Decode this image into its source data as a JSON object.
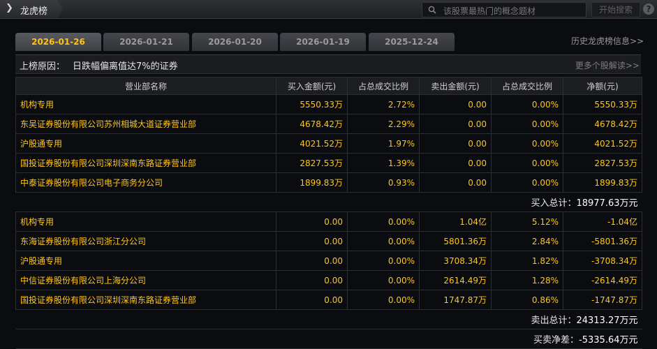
{
  "header": {
    "title": "龙虎榜",
    "search_placeholder": "该股票最热门的概念题材",
    "search_button": "开始搜索",
    "help": "?"
  },
  "tabs": [
    {
      "label": "2026-01-26",
      "active": true
    },
    {
      "label": "2026-01-21",
      "active": false
    },
    {
      "label": "2026-01-20",
      "active": false
    },
    {
      "label": "2026-01-19",
      "active": false
    },
    {
      "label": "2025-12-24",
      "active": false
    }
  ],
  "history_link": "历史龙虎榜信息>>",
  "reason": {
    "label": "上榜原因：",
    "text": "日跌幅偏离值达7%的证券",
    "more_link": "更多个股解读>>"
  },
  "table": {
    "columns": [
      "营业部名称",
      "买入金额(元)",
      "占总成交比例",
      "卖出金额(元)",
      "占总成交比例",
      "净额(元)"
    ],
    "buy_rows": [
      [
        "机构专用",
        "5550.33万",
        "2.72%",
        "0.00",
        "0.00%",
        "5550.33万"
      ],
      [
        "东吴证券股份有限公司苏州相城大道证券营业部",
        "4678.42万",
        "2.29%",
        "0.00",
        "0.00%",
        "4678.42万"
      ],
      [
        "沪股通专用",
        "4021.52万",
        "1.97%",
        "0.00",
        "0.00%",
        "4021.52万"
      ],
      [
        "国投证券股份有限公司深圳深南东路证券营业部",
        "2827.53万",
        "1.39%",
        "0.00",
        "0.00%",
        "2827.53万"
      ],
      [
        "中泰证券股份有限公司电子商务分公司",
        "1899.83万",
        "0.93%",
        "0.00",
        "0.00%",
        "1899.83万"
      ]
    ],
    "buy_total_label": "买入总计：",
    "buy_total_value": "18977.63万元",
    "sell_rows": [
      [
        "机构专用",
        "0.00",
        "0.00%",
        "1.04亿",
        "5.12%",
        "-1.04亿"
      ],
      [
        "东海证券股份有限公司浙江分公司",
        "0.00",
        "0.00%",
        "5801.36万",
        "2.84%",
        "-5801.36万"
      ],
      [
        "沪股通专用",
        "0.00",
        "0.00%",
        "3708.34万",
        "1.82%",
        "-3708.34万"
      ],
      [
        "中信证券股份有限公司上海分公司",
        "0.00",
        "0.00%",
        "2614.49万",
        "1.28%",
        "-2614.49万"
      ],
      [
        "国投证券股份有限公司深圳深南东路证券营业部",
        "0.00",
        "0.00%",
        "1747.87万",
        "0.86%",
        "-1747.87万"
      ]
    ],
    "sell_total_label": "卖出总计：",
    "sell_total_value": "24313.27万元",
    "net_label": "买卖净差：",
    "net_value": "-5335.64万元"
  },
  "colors": {
    "accent": "#ffc21a",
    "background": "#0b0c0f"
  }
}
